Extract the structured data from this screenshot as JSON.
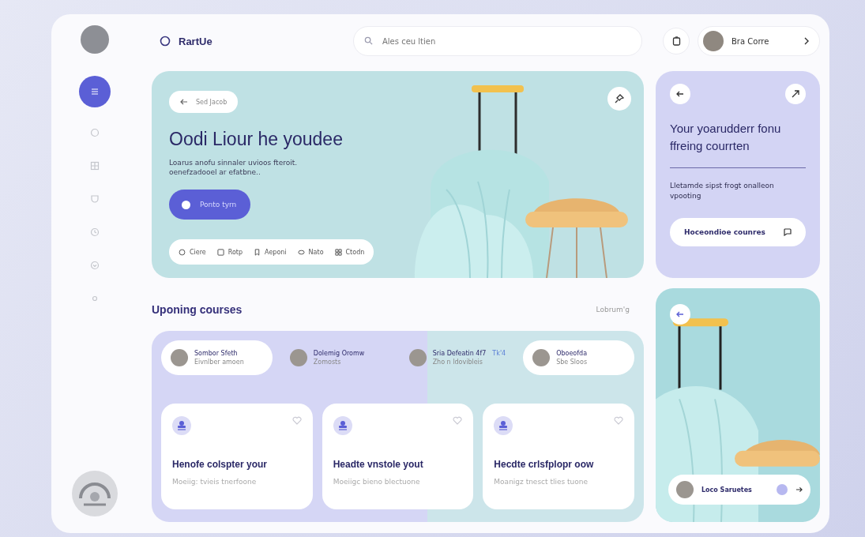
{
  "header": {
    "logo_text": "RartUe",
    "search": {
      "placeholder": "Ales ceu ltien"
    },
    "user": {
      "name": "Bra Corre"
    }
  },
  "sidebar": {
    "items": [
      {
        "selected": true
      },
      {
        "selected": false
      },
      {
        "selected": false
      },
      {
        "selected": false
      },
      {
        "selected": false
      },
      {
        "selected": false
      },
      {
        "selected": false
      }
    ]
  },
  "hero": {
    "back_chip": "Sed Jacob",
    "title": "Oodi Liour he youdee",
    "text": "Loarus anofu sinnaler uvioos fteroit. oenefzadooel ar efatbne..",
    "button": "Ponto tyrn",
    "toolbar": [
      {
        "label": "Ciere"
      },
      {
        "label": "Rotp"
      },
      {
        "label": "Aeponi"
      },
      {
        "label": "Nato"
      },
      {
        "label": "Ctodn"
      }
    ]
  },
  "promo": {
    "title": "Your yoarudderr fonu ffreing courrten",
    "text": "Lletamde sipst frogt onalleon vpooting",
    "button": "Hoceondioe counres"
  },
  "courses": {
    "title": "Uponing courses",
    "link": "Lobrum'g",
    "people": [
      {
        "name": "Sombor Sfeth",
        "subtitle": "Eivnlber amoen",
        "selected": true
      },
      {
        "name": "Dolemig Oromw",
        "subtitle": "Zomosts",
        "selected": false
      },
      {
        "name": "Sria Defeatin 4f7",
        "tag": "Tk'4",
        "subtitle": "Zho n ldovibleis",
        "selected": false
      },
      {
        "name": "Oboeofda",
        "subtitle": "Sbe Sloos",
        "selected": true
      }
    ],
    "cards": [
      {
        "title": "Henofe colspter your",
        "text": "Moeiig: tvieis tnerfoone"
      },
      {
        "title": "Headte vnstole yout",
        "text": "Moeiigc bieno blectuone"
      },
      {
        "title": "Hecdte crlsfplopr oow",
        "text": "Moanigz tnesct tlies tuone"
      }
    ]
  },
  "side_photo": {
    "chip": "Loco Saruetes"
  }
}
